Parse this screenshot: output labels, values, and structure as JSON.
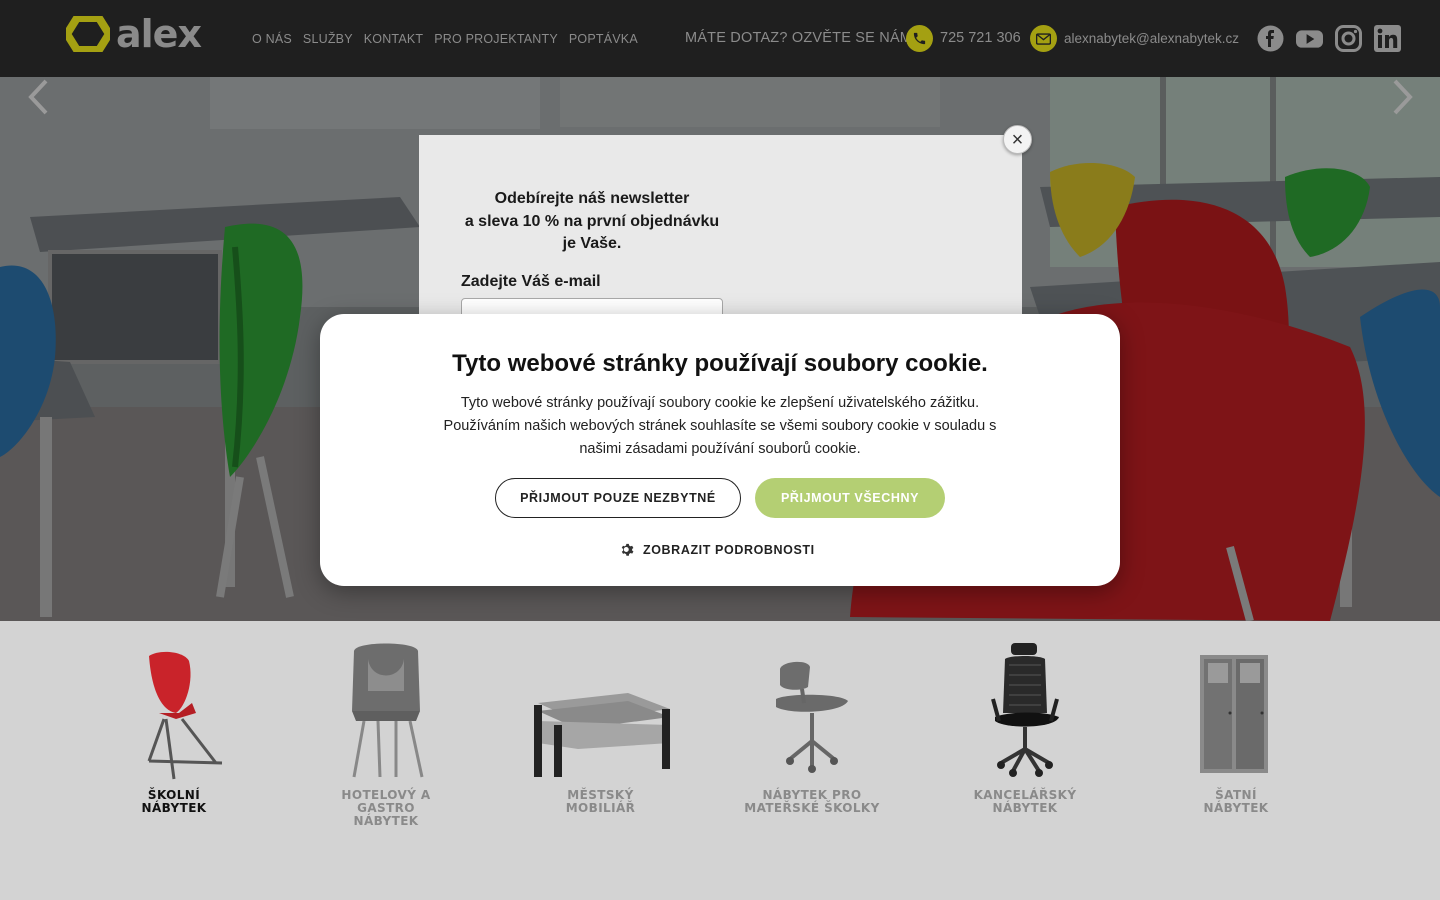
{
  "header": {
    "logo_text": "alex",
    "nav": [
      "O NÁS",
      "SLUŽBY",
      "KONTAKT",
      "PRO PROJEKTANTY",
      "POPTÁVKA"
    ],
    "contact_question": "MÁTE DOTAZ? OZVĚTE SE NÁM:",
    "phone": "725 721 306",
    "email": "alexnabytek@alexnabytek.cz",
    "social_icons": [
      "facebook-icon",
      "youtube-icon",
      "instagram-icon",
      "linkedin-icon"
    ],
    "accent_color": "#a4a012"
  },
  "hero": {
    "prev_icon": "chevron-left-icon",
    "next_icon": "chevron-right-icon"
  },
  "categories": [
    {
      "label": "ŠKOLNÍ\nNÁBYTEK",
      "icon": "school-chair-icon",
      "active": true
    },
    {
      "label": "HOTELOVÝ A GASTRO\nNÁBYTEK",
      "icon": "hotel-chair-icon",
      "active": false
    },
    {
      "label": "MĚSTSKÝ\nMOBILIÁŘ",
      "icon": "bench-icon",
      "active": false
    },
    {
      "label": "NÁBYTEK PRO\nMATEŘSKÉ ŠKOLKY",
      "icon": "kindergarten-chair-icon",
      "active": false
    },
    {
      "label": "KANCELÁŘSKÝ\nNÁBYTEK",
      "icon": "office-chair-icon",
      "active": false
    },
    {
      "label": "ŠATNÍ\nNÁBYTEK",
      "icon": "locker-icon",
      "active": false
    }
  ],
  "newsletter": {
    "title": "Odebírejte náš newsletter\na sleva 10 % na první objednávku\nje Vaše.",
    "email_label": "Zadejte Váš e-mail",
    "email_value": "",
    "close_label": "×"
  },
  "cookie": {
    "title": "Tyto webové stránky používají soubory cookie.",
    "text": "Tyto webové stránky používají soubory cookie ke zlepšení uživatelského zážitku. Používáním našich webových stránek souhlasíte se všemi soubory cookie v souladu s našimi zásadami používání souborů cookie.",
    "btn_necessary": "PŘIJMOUT POUZE NEZBYTNÉ",
    "btn_all": "PŘIJMOUT VŠECHNY",
    "details": "ZOBRAZIT PODROBNOSTI",
    "accept_all_color": "#b4cf73"
  }
}
